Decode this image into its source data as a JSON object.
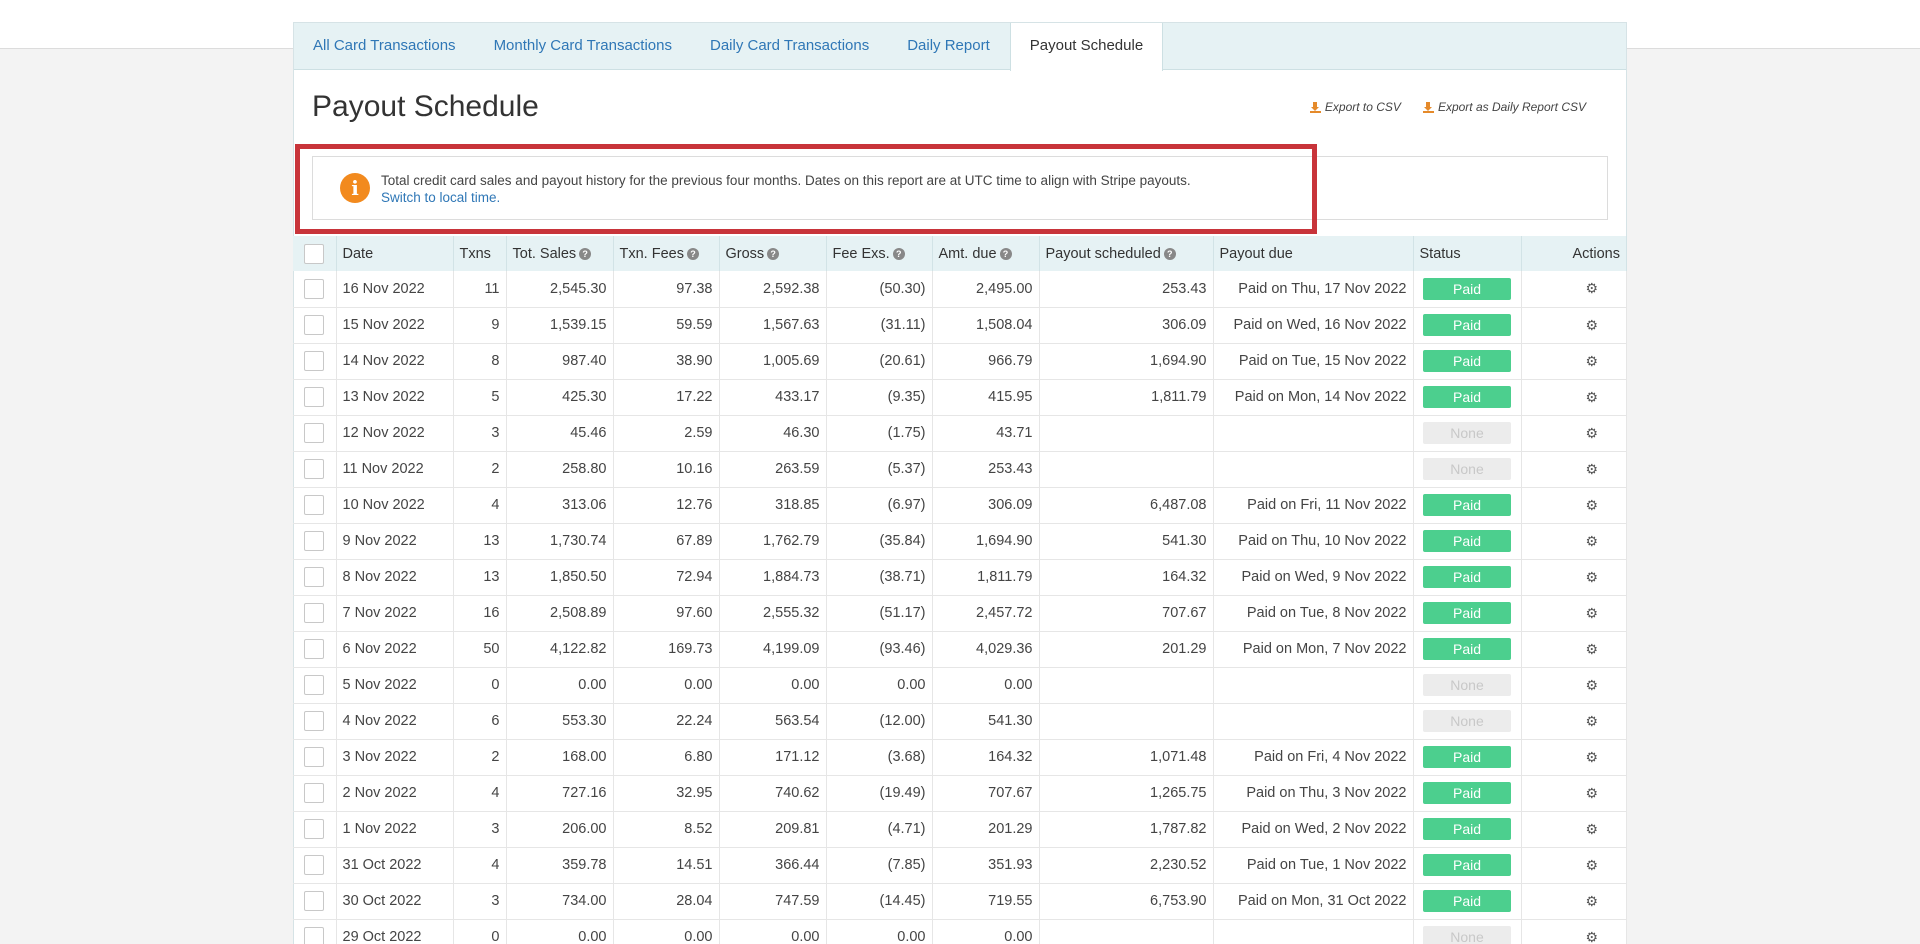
{
  "tabs": [
    {
      "label": "All Card Transactions"
    },
    {
      "label": "Monthly Card Transactions"
    },
    {
      "label": "Daily Card Transactions"
    },
    {
      "label": "Daily Report"
    },
    {
      "label": "Payout Schedule",
      "active": true
    }
  ],
  "page_title": "Payout Schedule",
  "exports": {
    "csv": "Export to CSV",
    "daily_csv": "Export as Daily Report CSV"
  },
  "notice": {
    "text": "Total credit card sales and payout history for the previous four months. Dates on this report are at UTC time to align with Stripe payouts.",
    "link": "Switch to local time."
  },
  "columns": {
    "date": "Date",
    "txns": "Txns",
    "tot_sales": "Tot. Sales",
    "txn_fees": "Txn. Fees",
    "gross": "Gross",
    "fee_exs": "Fee Exs.",
    "amt_due": "Amt. due",
    "payout_scheduled": "Payout scheduled",
    "payout_due": "Payout due",
    "status": "Status",
    "actions": "Actions"
  },
  "help_icon": "question-circle-icon",
  "action_icon": "gear-icon",
  "colors": {
    "paid": "#4ccf8e",
    "accent": "#2f77b6",
    "highlight": "#c8343a",
    "info": "#f28a1e"
  },
  "rows": [
    {
      "date": "16 Nov 2022",
      "txns": "11",
      "tot_sales": "2,545.30",
      "txn_fees": "97.38",
      "gross": "2,592.38",
      "fee_exs": "(50.30)",
      "amt_due": "2,495.00",
      "payout_scheduled": "253.43",
      "payout_due": "Paid on Thu, 17 Nov 2022",
      "status": "Paid"
    },
    {
      "date": "15 Nov 2022",
      "txns": "9",
      "tot_sales": "1,539.15",
      "txn_fees": "59.59",
      "gross": "1,567.63",
      "fee_exs": "(31.11)",
      "amt_due": "1,508.04",
      "payout_scheduled": "306.09",
      "payout_due": "Paid on Wed, 16 Nov 2022",
      "status": "Paid"
    },
    {
      "date": "14 Nov 2022",
      "txns": "8",
      "tot_sales": "987.40",
      "txn_fees": "38.90",
      "gross": "1,005.69",
      "fee_exs": "(20.61)",
      "amt_due": "966.79",
      "payout_scheduled": "1,694.90",
      "payout_due": "Paid on Tue, 15 Nov 2022",
      "status": "Paid"
    },
    {
      "date": "13 Nov 2022",
      "txns": "5",
      "tot_sales": "425.30",
      "txn_fees": "17.22",
      "gross": "433.17",
      "fee_exs": "(9.35)",
      "amt_due": "415.95",
      "payout_scheduled": "1,811.79",
      "payout_due": "Paid on Mon, 14 Nov 2022",
      "status": "Paid"
    },
    {
      "date": "12 Nov 2022",
      "txns": "3",
      "tot_sales": "45.46",
      "txn_fees": "2.59",
      "gross": "46.30",
      "fee_exs": "(1.75)",
      "amt_due": "43.71",
      "payout_scheduled": "",
      "payout_due": "",
      "status": "None"
    },
    {
      "date": "11 Nov 2022",
      "txns": "2",
      "tot_sales": "258.80",
      "txn_fees": "10.16",
      "gross": "263.59",
      "fee_exs": "(5.37)",
      "amt_due": "253.43",
      "payout_scheduled": "",
      "payout_due": "",
      "status": "None"
    },
    {
      "date": "10 Nov 2022",
      "txns": "4",
      "tot_sales": "313.06",
      "txn_fees": "12.76",
      "gross": "318.85",
      "fee_exs": "(6.97)",
      "amt_due": "306.09",
      "payout_scheduled": "6,487.08",
      "payout_due": "Paid on Fri, 11 Nov 2022",
      "status": "Paid"
    },
    {
      "date": "9 Nov 2022",
      "txns": "13",
      "tot_sales": "1,730.74",
      "txn_fees": "67.89",
      "gross": "1,762.79",
      "fee_exs": "(35.84)",
      "amt_due": "1,694.90",
      "payout_scheduled": "541.30",
      "payout_due": "Paid on Thu, 10 Nov 2022",
      "status": "Paid"
    },
    {
      "date": "8 Nov 2022",
      "txns": "13",
      "tot_sales": "1,850.50",
      "txn_fees": "72.94",
      "gross": "1,884.73",
      "fee_exs": "(38.71)",
      "amt_due": "1,811.79",
      "payout_scheduled": "164.32",
      "payout_due": "Paid on Wed, 9 Nov 2022",
      "status": "Paid"
    },
    {
      "date": "7 Nov 2022",
      "txns": "16",
      "tot_sales": "2,508.89",
      "txn_fees": "97.60",
      "gross": "2,555.32",
      "fee_exs": "(51.17)",
      "amt_due": "2,457.72",
      "payout_scheduled": "707.67",
      "payout_due": "Paid on Tue, 8 Nov 2022",
      "status": "Paid"
    },
    {
      "date": "6 Nov 2022",
      "txns": "50",
      "tot_sales": "4,122.82",
      "txn_fees": "169.73",
      "gross": "4,199.09",
      "fee_exs": "(93.46)",
      "amt_due": "4,029.36",
      "payout_scheduled": "201.29",
      "payout_due": "Paid on Mon, 7 Nov 2022",
      "status": "Paid"
    },
    {
      "date": "5 Nov 2022",
      "txns": "0",
      "tot_sales": "0.00",
      "txn_fees": "0.00",
      "gross": "0.00",
      "fee_exs": "0.00",
      "amt_due": "0.00",
      "payout_scheduled": "",
      "payout_due": "",
      "status": "None"
    },
    {
      "date": "4 Nov 2022",
      "txns": "6",
      "tot_sales": "553.30",
      "txn_fees": "22.24",
      "gross": "563.54",
      "fee_exs": "(12.00)",
      "amt_due": "541.30",
      "payout_scheduled": "",
      "payout_due": "",
      "status": "None"
    },
    {
      "date": "3 Nov 2022",
      "txns": "2",
      "tot_sales": "168.00",
      "txn_fees": "6.80",
      "gross": "171.12",
      "fee_exs": "(3.68)",
      "amt_due": "164.32",
      "payout_scheduled": "1,071.48",
      "payout_due": "Paid on Fri, 4 Nov 2022",
      "status": "Paid"
    },
    {
      "date": "2 Nov 2022",
      "txns": "4",
      "tot_sales": "727.16",
      "txn_fees": "32.95",
      "gross": "740.62",
      "fee_exs": "(19.49)",
      "amt_due": "707.67",
      "payout_scheduled": "1,265.75",
      "payout_due": "Paid on Thu, 3 Nov 2022",
      "status": "Paid"
    },
    {
      "date": "1 Nov 2022",
      "txns": "3",
      "tot_sales": "206.00",
      "txn_fees": "8.52",
      "gross": "209.81",
      "fee_exs": "(4.71)",
      "amt_due": "201.29",
      "payout_scheduled": "1,787.82",
      "payout_due": "Paid on Wed, 2 Nov 2022",
      "status": "Paid"
    },
    {
      "date": "31 Oct 2022",
      "txns": "4",
      "tot_sales": "359.78",
      "txn_fees": "14.51",
      "gross": "366.44",
      "fee_exs": "(7.85)",
      "amt_due": "351.93",
      "payout_scheduled": "2,230.52",
      "payout_due": "Paid on Tue, 1 Nov 2022",
      "status": "Paid"
    },
    {
      "date": "30 Oct 2022",
      "txns": "3",
      "tot_sales": "734.00",
      "txn_fees": "28.04",
      "gross": "747.59",
      "fee_exs": "(14.45)",
      "amt_due": "719.55",
      "payout_scheduled": "6,753.90",
      "payout_due": "Paid on Mon, 31 Oct 2022",
      "status": "Paid"
    },
    {
      "date": "29 Oct 2022",
      "txns": "0",
      "tot_sales": "0.00",
      "txn_fees": "0.00",
      "gross": "0.00",
      "fee_exs": "0.00",
      "amt_due": "0.00",
      "payout_scheduled": "",
      "payout_due": "",
      "status": "None"
    }
  ]
}
